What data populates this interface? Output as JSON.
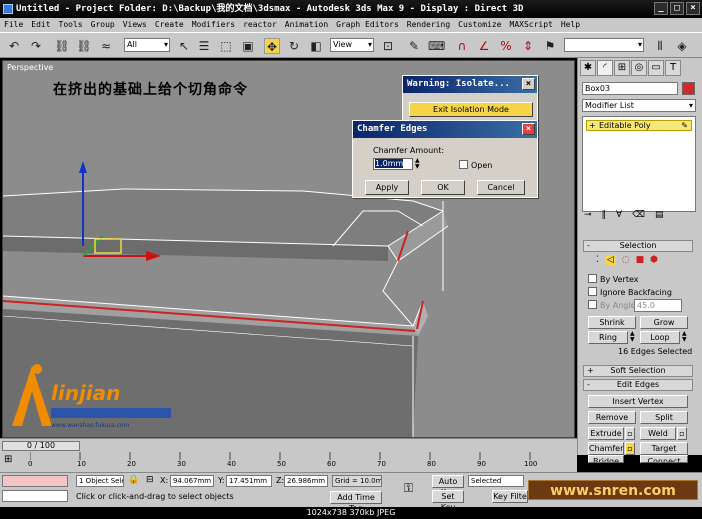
{
  "window": {
    "title": "Untitled      - Project Folder: D:\\Backup\\我的文档\\3dsmax      - Autodesk 3ds Max 9      - Display : Direct 3D"
  },
  "menu": [
    "File",
    "Edit",
    "Tools",
    "Group",
    "Views",
    "Create",
    "Modifiers",
    "reactor",
    "Animation",
    "Graph Editors",
    "Rendering",
    "Customize",
    "MAXScript",
    "Help"
  ],
  "toolbar": {
    "filter_value": "All",
    "coord_value": "View"
  },
  "viewport": {
    "label": "Perspective",
    "caption": "在挤出的基础上给个切角命令"
  },
  "warning_dialog": {
    "title": "Warning: Isolate...",
    "exit_label": "Exit Isolation Mode"
  },
  "chamfer_dialog": {
    "title": "Chamfer Edges",
    "amount_label": "Chamfer Amount:",
    "amount_value": "1.0mm",
    "open_label": "Open",
    "apply_label": "Apply",
    "ok_label": "OK",
    "cancel_label": "Cancel"
  },
  "command_panel": {
    "object_name": "Box03",
    "modifier_list": "Modifier List",
    "stack_item": "Editable Poly",
    "selection": {
      "header": "Selection",
      "by_vertex": "By Vertex",
      "ignore_backfacing": "Ignore Backfacing",
      "by_angle": "By Angle:",
      "angle_value": "45.0",
      "shrink": "Shrink",
      "grow": "Grow",
      "ring": "Ring",
      "loop": "Loop",
      "status": "16 Edges Selected"
    },
    "soft_selection": "Soft Selection",
    "edit_edges": {
      "header": "Edit Edges",
      "insert_vertex": "Insert Vertex",
      "remove": "Remove",
      "split": "Split",
      "extrude": "Extrude",
      "weld": "Weld",
      "chamfer": "Chamfer",
      "target_weld": "Target Weld",
      "bridge": "Bridge",
      "connect": "Connect"
    }
  },
  "timeline": {
    "slider_label": "0 / 100",
    "ticks": [
      "0",
      "10",
      "20",
      "30",
      "40",
      "50",
      "60",
      "70",
      "80",
      "90",
      "100"
    ]
  },
  "status": {
    "selection": "1 Object Sele",
    "x_label": "X:",
    "x_value": "94.067mm",
    "y_label": "Y:",
    "y_value": "17.451mm",
    "z_label": "Z:",
    "z_value": "26.986mm",
    "grid": "Grid = 10.0mm",
    "prompt": "Click or click-and-drag to select objects",
    "add_time_tag": "Add Time Tag",
    "auto_key": "Auto Key",
    "set_key": "Set Key",
    "selected": "Selected",
    "key_filters": "Key Filte"
  },
  "logo": {
    "name": "linjian",
    "url": "www.wanshao.fukura.com"
  },
  "watermark": "www.snren.com",
  "footer": "1024x738  370kb  JPEG",
  "colors": {
    "viewport_bg": "#8c8c8c",
    "selected_edge": "#cc2222",
    "dialog_title": "#0a246a",
    "exit_button": "#f5d547"
  }
}
